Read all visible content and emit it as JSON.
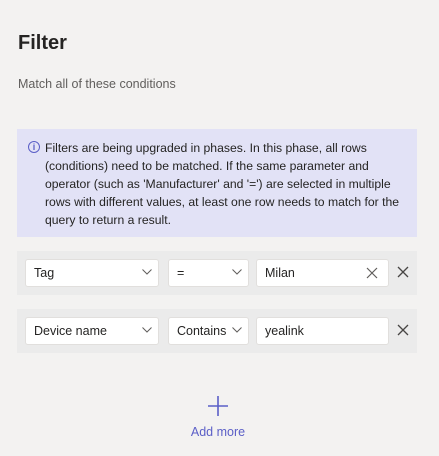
{
  "header": {
    "title": "Filter",
    "subtitle": "Match all of these conditions"
  },
  "info": {
    "icon": "info-icon",
    "text": "Filters are being upgraded in phases. In this phase, all rows (conditions) need to be matched. If the same parameter and operator (such as 'Manufacturer' and '=') are selected in multiple rows with different values, at least one row needs to match for the query to return a result."
  },
  "conditions": [
    {
      "parameter": "Tag",
      "operator": "=",
      "value": "Milan"
    },
    {
      "parameter": "Device name",
      "operator": "Contains",
      "value": "yealink"
    }
  ],
  "add_more": {
    "label": "Add more",
    "icon": "plus-icon"
  },
  "colors": {
    "accent": "#5b5fc7",
    "info_background": "#e2e2f6",
    "page_background": "#f3f2f1"
  }
}
